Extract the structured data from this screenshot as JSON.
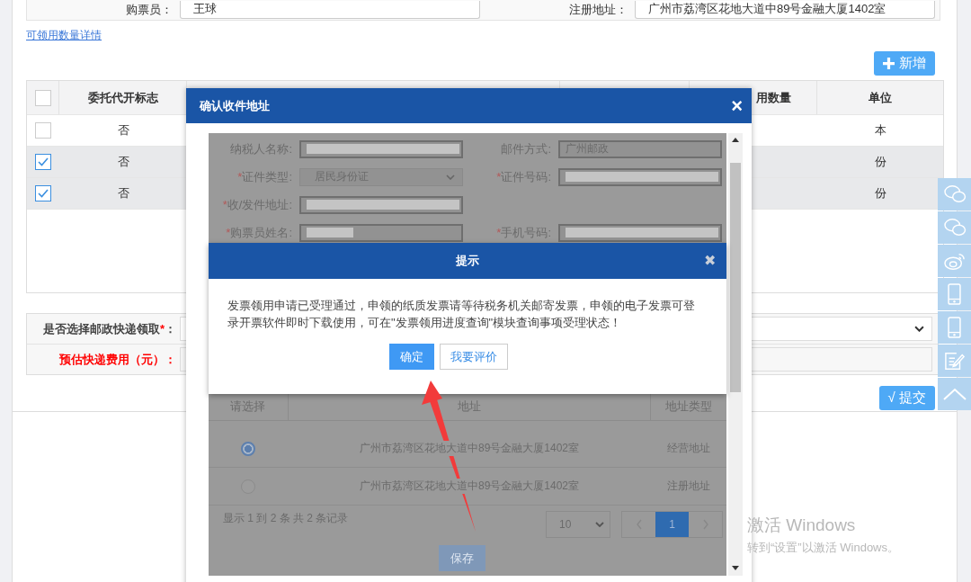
{
  "top_fields": [
    {
      "label": "购票员：",
      "value": "王球"
    },
    {
      "label": "注册地址：",
      "value": "广州市荔湾区花地大道中89号金融大厦1402室"
    }
  ],
  "details_link": "可领用数量详情",
  "add_button": "新增",
  "table": {
    "all_checked": false,
    "columns": [
      "委托代开标志",
      "用数量",
      "单位"
    ],
    "rows": [
      {
        "checked": false,
        "entrust": "否",
        "unit": "本"
      },
      {
        "checked": true,
        "entrust": "否",
        "unit": "份"
      },
      {
        "checked": true,
        "entrust": "否",
        "unit": "份"
      }
    ]
  },
  "form": [
    {
      "kind": "select",
      "label": "是否选择邮政快递领取",
      "mark": "*",
      "colon": "：",
      "alert": false
    },
    {
      "kind": "input",
      "label": "预估快递费用（元）",
      "colon": "：",
      "alert": true
    }
  ],
  "submit_button": "√ 提交",
  "address_dialog": {
    "title": "确认收件地址",
    "close": "×",
    "field_rows": [
      [
        {
          "label": "纳税人名称:",
          "kind": "input",
          "redacted": true
        },
        {
          "label": "邮件方式:",
          "kind": "input",
          "value": "广州邮政"
        }
      ],
      [
        {
          "mark": "*",
          "label": "证件类型:",
          "kind": "select",
          "value": "居民身份证"
        },
        {
          "mark": "*",
          "label": "证件号码:",
          "kind": "input",
          "redacted": true
        }
      ],
      [
        {
          "mark": "*",
          "label": "收/发件地址:",
          "kind": "input",
          "redacted": true
        }
      ],
      [
        {
          "mark": "*",
          "label": "购票员姓名:",
          "kind": "input",
          "redacted": true
        },
        {
          "mark": "*",
          "label": "手机号码:",
          "kind": "input",
          "redacted": true
        }
      ]
    ],
    "columns": [
      "请选择",
      "地址",
      "地址类型"
    ],
    "rows": [
      {
        "selected": true,
        "address": "广州市荔湾区花地大道中89号金融大厦1402室",
        "type": "经营地址"
      },
      {
        "selected": false,
        "address": "广州市荔湾区花地大道中89号金融大厦1402室",
        "type": "注册地址"
      }
    ],
    "info": "显示 1 到 2 条 共 2 条记录",
    "page_size": "10",
    "pages": [
      {
        "label": "1",
        "selected": true
      }
    ],
    "save_button": "保存"
  },
  "alert": {
    "title": "提示",
    "close": "✖",
    "message": "发票领用申请已受理通过，申领的纸质发票请等待税务机关邮寄发票，申领的电子发票可登录开票软件即时下载使用，可在\"发票领用进度查询\"模块查询事项受理状态！",
    "buttons": [
      {
        "label": "确定",
        "primary": true
      },
      {
        "label": "我要评价",
        "primary": false
      }
    ]
  },
  "activation": {
    "title": "激活 Windows",
    "subtitle": "转到“设置”以激活 Windows。"
  }
}
